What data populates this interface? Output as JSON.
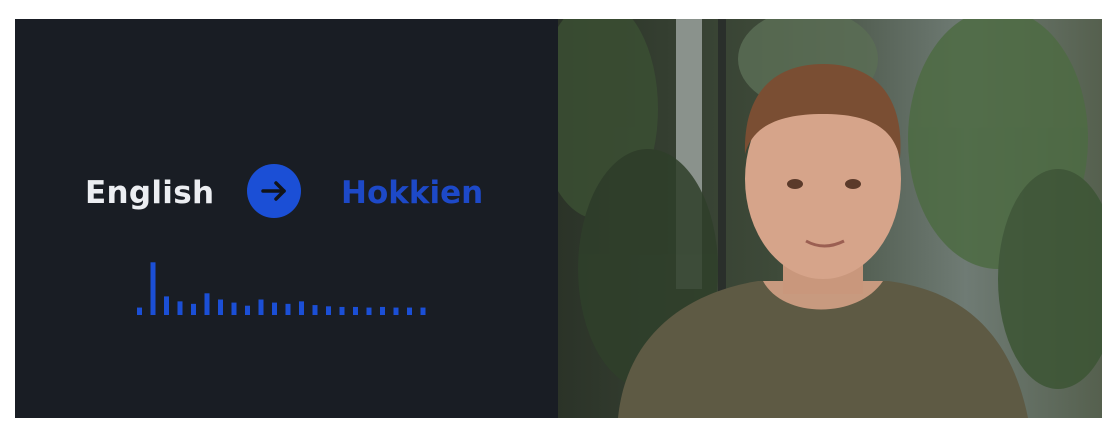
{
  "translation": {
    "source_language": "English",
    "target_language": "Hokkien",
    "arrow_icon": "arrow-right-icon",
    "accent_color": "#1b4fd6",
    "waveform_levels": [
      0.12,
      0.85,
      0.3,
      0.22,
      0.18,
      0.35,
      0.25,
      0.2,
      0.15,
      0.25,
      0.2,
      0.18,
      0.22,
      0.16,
      0.14,
      0.13,
      0.13,
      0.12,
      0.13,
      0.12,
      0.12,
      0.12
    ]
  },
  "video": {
    "subject": "person",
    "background_color": "#3e4a39"
  }
}
